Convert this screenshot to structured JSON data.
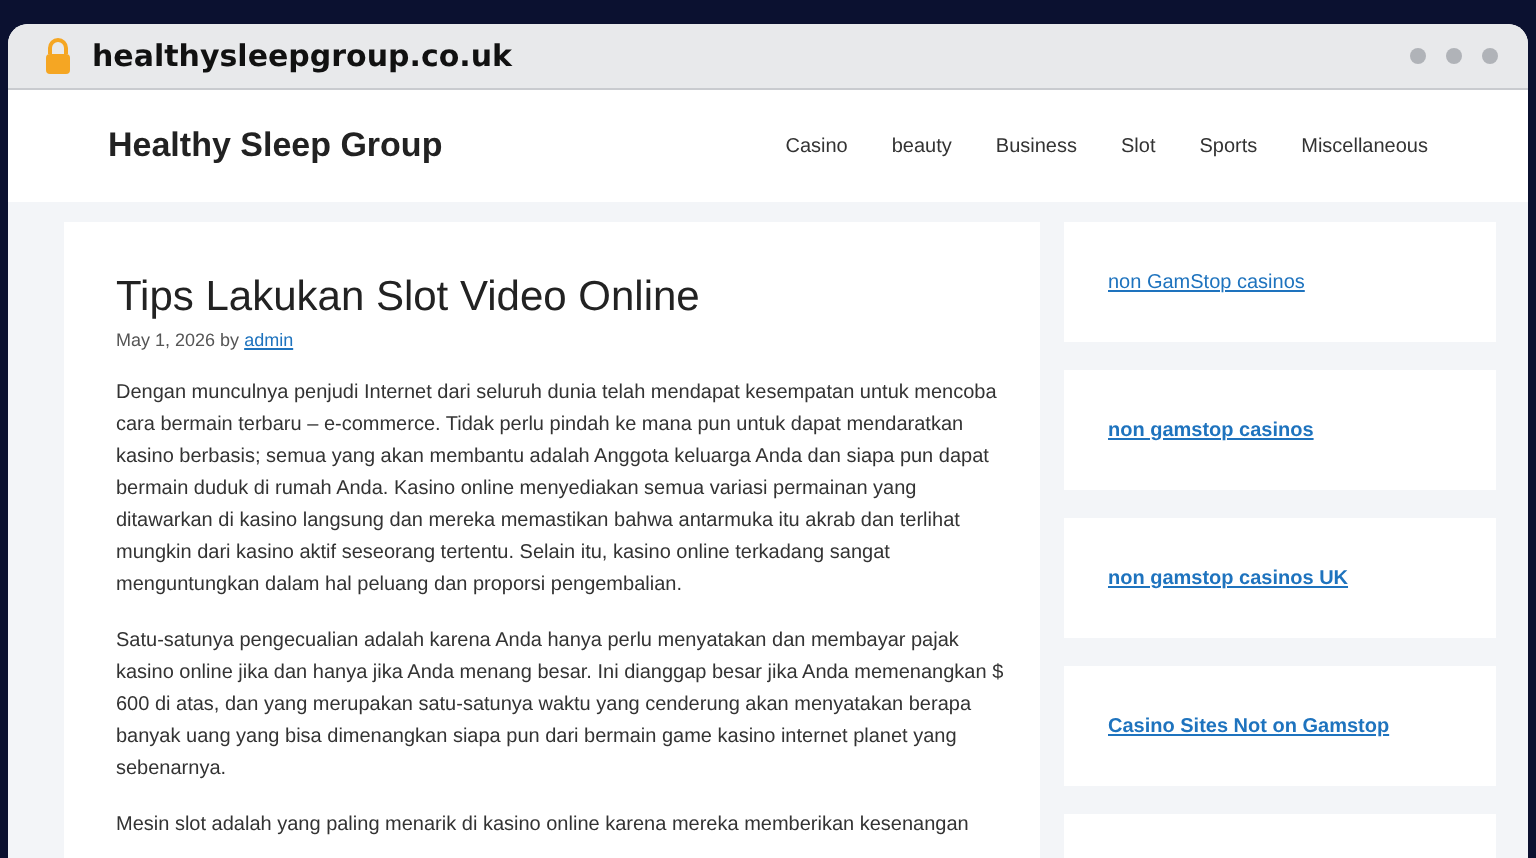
{
  "browser": {
    "url": "healthysleepgroup.co.uk"
  },
  "site": {
    "title": "Healthy Sleep Group",
    "nav": [
      {
        "label": "Casino"
      },
      {
        "label": "beauty"
      },
      {
        "label": "Business"
      },
      {
        "label": "Slot"
      },
      {
        "label": "Sports"
      },
      {
        "label": "Miscellaneous"
      }
    ]
  },
  "article": {
    "title": "Tips Lakukan Slot Video Online",
    "date": "May 1, 2026",
    "by": "by",
    "author": "admin",
    "paragraphs": [
      "Dengan munculnya penjudi Internet dari seluruh dunia telah mendapat kesempatan untuk mencoba cara bermain terbaru – e-commerce. Tidak perlu pindah ke mana pun untuk dapat mendaratkan kasino berbasis; semua yang akan membantu adalah Anggota keluarga Anda dan siapa pun dapat bermain duduk di rumah Anda. Kasino online menyediakan semua variasi permainan yang ditawarkan di kasino langsung dan mereka memastikan bahwa antarmuka itu akrab dan terlihat mungkin dari kasino aktif seseorang tertentu. Selain itu, kasino online terkadang sangat menguntungkan dalam hal peluang dan proporsi pengembalian.",
      "Satu-satunya pengecualian adalah karena Anda hanya perlu menyatakan dan membayar pajak kasino online jika dan hanya jika Anda menang besar. Ini dianggap besar jika Anda memenangkan $ 600 di atas, dan yang merupakan satu-satunya waktu yang cenderung akan menyatakan berapa banyak uang yang bisa dimenangkan siapa pun dari bermain game kasino internet planet yang sebenarnya.",
      "Mesin slot adalah yang paling menarik di kasino online karena mereka memberikan kesenangan"
    ]
  },
  "sidebar": {
    "links": [
      {
        "label": "non GamStop casinos",
        "bold": false
      },
      {
        "label": "non gamstop casinos",
        "bold": true
      },
      {
        "label": "non gamstop casinos UK",
        "bold": true
      },
      {
        "label": "Casino Sites Not on Gamstop",
        "bold": true
      }
    ]
  }
}
